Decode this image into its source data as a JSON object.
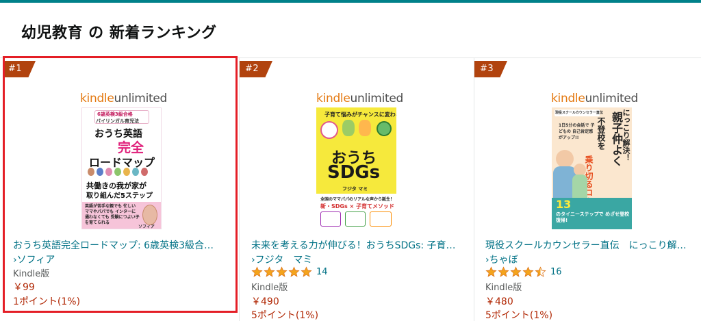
{
  "heading": "幼児教育 の 新着ランキング",
  "colors": {
    "accent_bar": "#00818a",
    "rank_badge": "#b1430e",
    "selected_frame": "#e41e26",
    "link": "#007185",
    "price": "#b12704",
    "star": "#f4a41c"
  },
  "logo": {
    "kindle": "kindle",
    "unlimited": "unlimited"
  },
  "items": [
    {
      "rank": "#1",
      "cover": {
        "band_top": "6歳英検3級合格",
        "band_sub": "バイリンガル育児法",
        "title1": "おうち英語",
        "title2": "完全",
        "title3": "ロードマップ",
        "sub1": "共働きの我が家が",
        "sub2": "取り組んだ5ステップ",
        "blurb": "英語が苦手な親でも 忙しいママやパパでも インターに通わなくても 受験につよい子を育てられる",
        "author": "ソフィア"
      },
      "title": "おうち英語完全ロードマップ: 6歳英検3級合…",
      "author": "›ソフィア",
      "format": "Kindle版",
      "price": "￥99",
      "points": "1ポイント(1%)"
    },
    {
      "rank": "#2",
      "cover": {
        "tagline": "子育て悩みがチャンスに変わる",
        "title1": "おうち",
        "title2": "SDGs",
        "author": "フジタ マミ",
        "band": "全国のママパパのリアルな声から誕生！",
        "band2": "新・SDGs × 子育てメソッド"
      },
      "title": "未来を考える力が伸びる！おうちSDGs: 子育…",
      "author": "›フジタ　マミ",
      "rating_value": 5.0,
      "rating_count": "14",
      "format": "Kindle版",
      "price": "￥490",
      "points": "5ポイント(1%)"
    },
    {
      "rank": "#3",
      "cover": {
        "top": "現役スクールカウンセラー直伝",
        "t1": "にっこり解決！",
        "t2": "親子仲よく",
        "t3": "不登校を",
        "t4": "乗り切るコツ",
        "note": "1日5分の会話で 子どもの 自己肯定感がアップ!!",
        "num": "13",
        "step": "のタイニーステップで めざせ登校復帰!"
      },
      "title": "現役スクールカウンセラー直伝　にっこり解…",
      "author": "›ちゃぼ",
      "rating_value": 4.5,
      "rating_count": "16",
      "format": "Kindle版",
      "price": "￥480",
      "points": "5ポイント(1%)"
    }
  ]
}
